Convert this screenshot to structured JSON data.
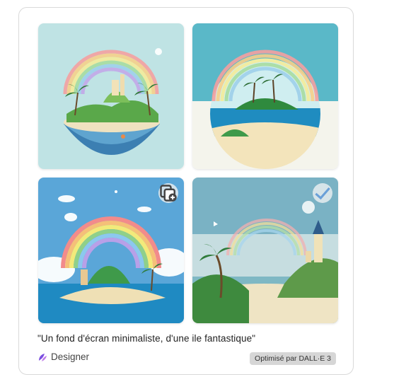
{
  "caption": "\"Un fond d'écran minimaliste, d'une ile fantastique\"",
  "brand": {
    "label": "Designer",
    "icon": "designer-logo-icon"
  },
  "badge": {
    "label": "Optimisé par DALL·E 3"
  },
  "images": [
    {
      "id": "image-1",
      "selected": false
    },
    {
      "id": "image-2",
      "selected": false
    },
    {
      "id": "image-3",
      "selected": false,
      "action_icon": "copy-add-icon"
    },
    {
      "id": "image-4",
      "selected": true,
      "action_icon": "checkmark-icon"
    }
  ],
  "colors": {
    "accent": "#7a4fe0",
    "badge_bg": "#d6d6d6",
    "check": "#6aa0d8"
  }
}
